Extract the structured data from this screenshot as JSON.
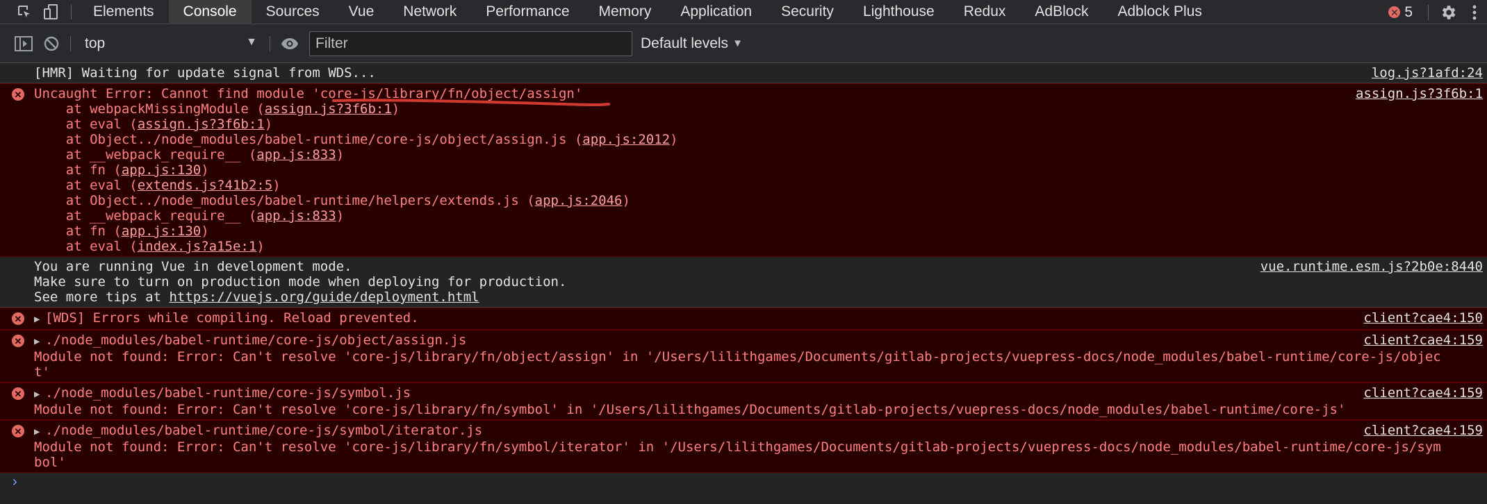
{
  "tabs": [
    "Elements",
    "Console",
    "Sources",
    "Vue",
    "Network",
    "Performance",
    "Memory",
    "Application",
    "Security",
    "Lighthouse",
    "Redux",
    "AdBlock",
    "Adblock Plus"
  ],
  "active_tab": "Console",
  "error_count": "5",
  "toolbar": {
    "context": "top",
    "filter_placeholder": "Filter",
    "levels_label": "Default levels"
  },
  "messages": {
    "hmr": {
      "text": "[HMR] Waiting for update signal from WDS...",
      "source": "log.js?1afd:24"
    },
    "uncaught": {
      "text": "Uncaught Error: Cannot find module 'core-js/library/fn/object/assign'",
      "source": "assign.js?3f6b:1",
      "stack": [
        {
          "pre": "    at webpackMissingModule (",
          "link": "assign.js?3f6b:1",
          "post": ")"
        },
        {
          "pre": "    at eval (",
          "link": "assign.js?3f6b:1",
          "post": ")"
        },
        {
          "pre": "    at Object../node_modules/babel-runtime/core-js/object/assign.js (",
          "link": "app.js:2012",
          "post": ")"
        },
        {
          "pre": "    at __webpack_require__ (",
          "link": "app.js:833",
          "post": ")"
        },
        {
          "pre": "    at fn (",
          "link": "app.js:130",
          "post": ")"
        },
        {
          "pre": "    at eval (",
          "link": "extends.js?41b2:5",
          "post": ")"
        },
        {
          "pre": "    at Object../node_modules/babel-runtime/helpers/extends.js (",
          "link": "app.js:2046",
          "post": ")"
        },
        {
          "pre": "    at __webpack_require__ (",
          "link": "app.js:833",
          "post": ")"
        },
        {
          "pre": "    at fn (",
          "link": "app.js:130",
          "post": ")"
        },
        {
          "pre": "    at eval (",
          "link": "index.js?a15e:1",
          "post": ")"
        }
      ]
    },
    "vue": {
      "line1": "You are running Vue in development mode.",
      "line2": "Make sure to turn on production mode when deploying for production.",
      "line3_pre": "See more tips at ",
      "line3_link": "https://vuejs.org/guide/deployment.html",
      "source": "vue.runtime.esm.js?2b0e:8440"
    },
    "wds": {
      "text": "[WDS] Errors while compiling. Reload prevented.",
      "source": "client?cae4:150"
    },
    "err1": {
      "head": "./node_modules/babel-runtime/core-js/object/assign.js",
      "body": "Module not found: Error: Can't resolve 'core-js/library/fn/object/assign' in '/Users/lilithgames/Documents/gitlab-projects/vuepress-docs/node_modules/babel-runtime/core-js/object'",
      "source": "client?cae4:159"
    },
    "err2": {
      "head": "./node_modules/babel-runtime/core-js/symbol.js",
      "body": "Module not found: Error: Can't resolve 'core-js/library/fn/symbol' in '/Users/lilithgames/Documents/gitlab-projects/vuepress-docs/node_modules/babel-runtime/core-js'",
      "source": "client?cae4:159"
    },
    "err3": {
      "head": "./node_modules/babel-runtime/core-js/symbol/iterator.js",
      "body": "Module not found: Error: Can't resolve 'core-js/library/fn/symbol/iterator' in '/Users/lilithgames/Documents/gitlab-projects/vuepress-docs/node_modules/babel-runtime/core-js/symbol'",
      "source": "client?cae4:159"
    }
  },
  "colors": {
    "error_bg": "#290000",
    "error_text": "#ff8080",
    "annotation": "#d23a2f"
  }
}
